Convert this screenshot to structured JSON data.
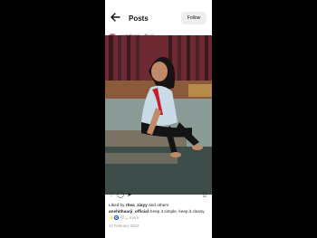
{
  "header": {
    "title": "Posts",
    "follow_label": "Follow"
  },
  "post": {
    "username": "anshithaarji_official",
    "liked_by_prefix": "Liked by",
    "liked_by_user": "rhea_ziayy",
    "liked_by_suffix": "and others",
    "caption_user": "anshithaarji_official",
    "caption_text": "Keep it simple, keep it classy.",
    "caption_emoji": "✨🧿🤍...",
    "more_label": "more",
    "date": "14 February 2023"
  },
  "icons": [
    "back-arrow-icon",
    "heart-icon",
    "comment-icon",
    "share-icon",
    "bookmark-icon"
  ],
  "colors": {
    "scarf_red": "#c41e2a",
    "shirt_blue": "#c9dbe6",
    "wall_red": "#7a2430"
  }
}
